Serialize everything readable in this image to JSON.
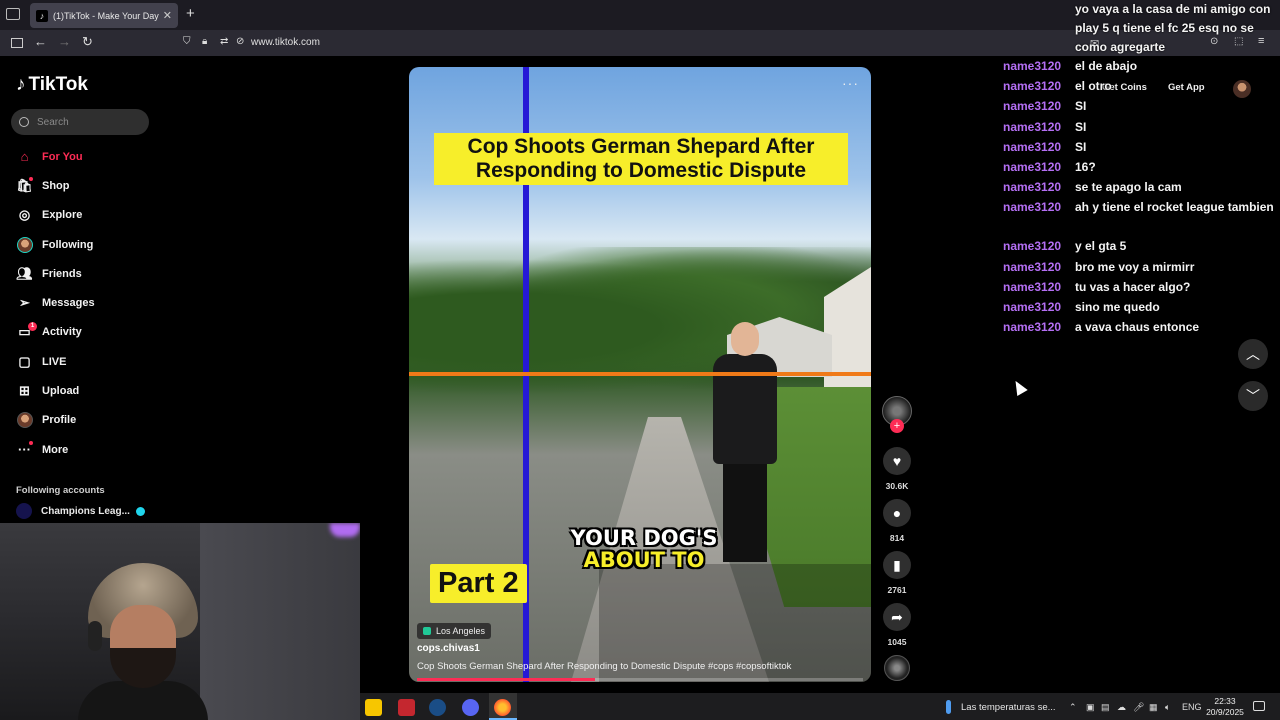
{
  "browser": {
    "tab_title": "(1)TikTok - Make Your Day",
    "tab_favicon": "tiktok-icon",
    "url": "www.tiktok.com"
  },
  "sidebar": {
    "logo": "TikTok",
    "search_placeholder": "Search",
    "items": [
      {
        "label": "For You",
        "icon": "home-icon"
      },
      {
        "label": "Shop",
        "icon": "shopping-bag-icon"
      },
      {
        "label": "Explore",
        "icon": "compass-icon"
      },
      {
        "label": "Following",
        "icon": "avatar"
      },
      {
        "label": "Friends",
        "icon": "friends-icon"
      },
      {
        "label": "Messages",
        "icon": "paper-plane-icon"
      },
      {
        "label": "Activity",
        "icon": "activity-icon",
        "badge": "1"
      },
      {
        "label": "LIVE",
        "icon": "live-icon"
      },
      {
        "label": "Upload",
        "icon": "plus-square-icon"
      },
      {
        "label": "Profile",
        "icon": "avatar"
      },
      {
        "label": "More",
        "icon": "ellipsis-icon"
      }
    ],
    "following_title": "Following accounts",
    "following_item": "Champions Leag..."
  },
  "video": {
    "banner": "Cop Shoots German Shepard After Responding to Domestic Dispute",
    "caption_line1": "YOUR DOG'S",
    "caption_line2": "ABOUT TO",
    "part": "Part 2",
    "location": "Los Angeles",
    "author": "cops.chivas1",
    "description": "Cop Shoots German Shepard After Responding to Domestic Dispute #cops  #copsoftiktok",
    "progress": 0.4
  },
  "actions": {
    "likes": "30.6K",
    "comments": "814",
    "saves": "2761",
    "shares": "1045"
  },
  "header": {
    "get_coins": "Get Coins",
    "get_app": "Get App"
  },
  "chat": {
    "top_message": "yo vaya a la casa de mi amigo con play 5 q tiene el fc 25 esq no se como agregarte",
    "lines": [
      {
        "name": "name3120",
        "msg": "el de abajo"
      },
      {
        "name": "name3120",
        "msg": "el otro"
      },
      {
        "name": "name3120",
        "msg": "SI"
      },
      {
        "name": "name3120",
        "msg": "SI"
      },
      {
        "name": "name3120",
        "msg": "SI"
      },
      {
        "name": "name3120",
        "msg": "16?"
      },
      {
        "name": "name3120",
        "msg": "se te apago la cam"
      },
      {
        "name": "name3120",
        "msg": "ah y tiene el rocket league tambien"
      },
      {
        "name": "name3120",
        "msg": "y el gta 5"
      },
      {
        "name": "name3120",
        "msg": "bro me voy a mirmirr"
      },
      {
        "name": "name3120",
        "msg": "tu vas a hacer algo?"
      },
      {
        "name": "name3120",
        "msg": "sino me quedo"
      },
      {
        "name": "name3120",
        "msg": "a vava chaus entonce"
      }
    ]
  },
  "taskbar": {
    "weather": "Las temperaturas se...",
    "lang": "ENG",
    "time": "22:33",
    "date": "20/9/2025"
  },
  "colors": {
    "accent": "#fe2c55",
    "chat_name": "#b46ff3",
    "banner_yellow": "#f7ee2a"
  }
}
